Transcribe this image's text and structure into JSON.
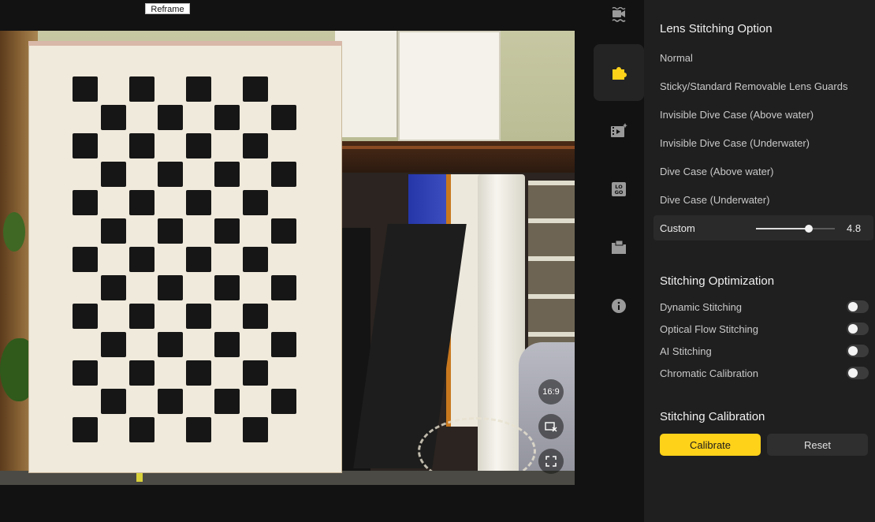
{
  "preview": {
    "reframe_label": "Reframe",
    "aspect_label": "16:9"
  },
  "nav": [
    {
      "name": "video-settings",
      "icon": "video-wave-icon",
      "active": false
    },
    {
      "name": "lens-stitching",
      "icon": "puzzle-icon",
      "active": true
    },
    {
      "name": "video-effects",
      "icon": "film-sparkle-icon",
      "active": false
    },
    {
      "name": "logo",
      "icon": "logo-icon",
      "active": false
    },
    {
      "name": "export",
      "icon": "folder-icon",
      "active": false
    },
    {
      "name": "info",
      "icon": "info-icon",
      "active": false
    }
  ],
  "lens_stitching": {
    "title": "Lens Stitching Option",
    "options": [
      "Normal",
      "Sticky/Standard Removable Lens Guards",
      "Invisible Dive Case (Above water)",
      "Invisible Dive Case (Underwater)",
      "Dive Case (Above water)",
      "Dive Case (Underwater)"
    ],
    "custom": {
      "label": "Custom",
      "value": "4.8",
      "fraction": 0.67
    }
  },
  "optimization": {
    "title": "Stitching Optimization",
    "toggles": [
      {
        "label": "Dynamic Stitching",
        "on": false
      },
      {
        "label": "Optical Flow Stitching",
        "on": false
      },
      {
        "label": "AI Stitching",
        "on": false
      },
      {
        "label": "Chromatic Calibration",
        "on": false
      }
    ]
  },
  "calibration": {
    "title": "Stitching Calibration",
    "calibrate_label": "Calibrate",
    "reset_label": "Reset"
  },
  "colors": {
    "accent": "#ffd21a",
    "panel_bg": "#1f1f1f",
    "app_bg": "#121212"
  }
}
